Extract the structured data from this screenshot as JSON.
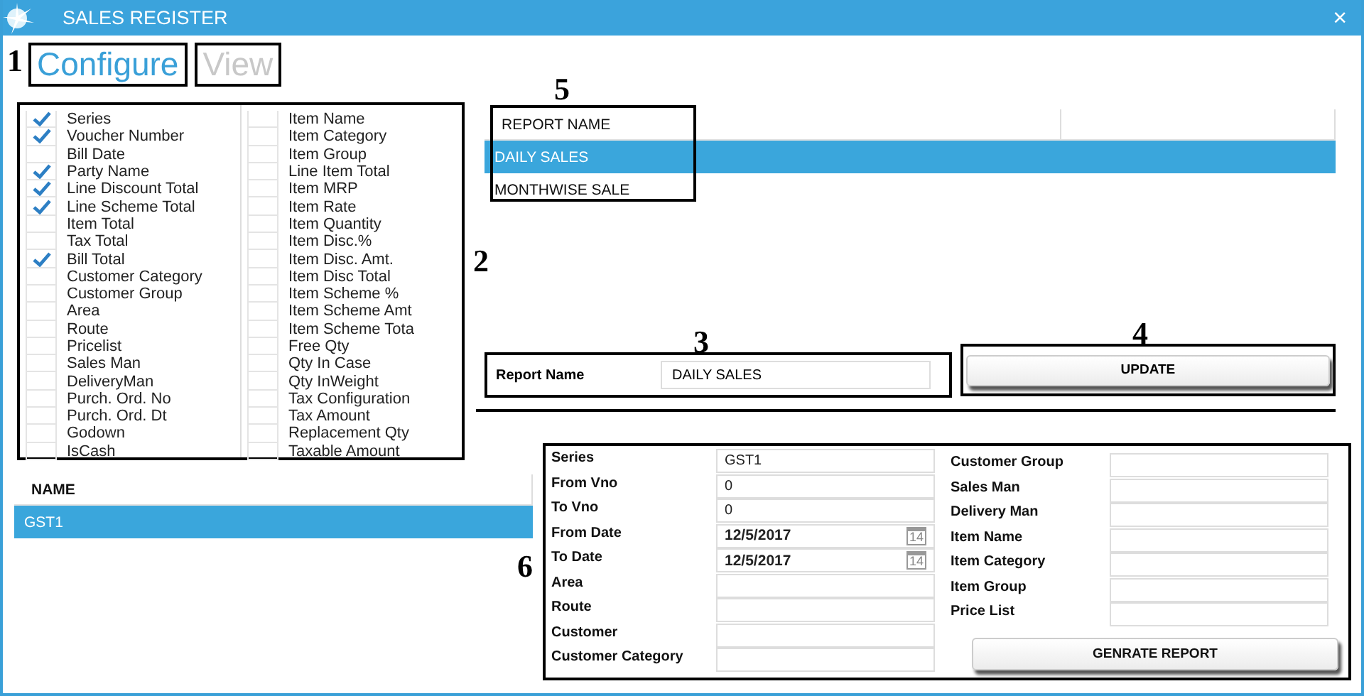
{
  "window": {
    "title": "SALES REGISTER",
    "close": "×"
  },
  "tabs": [
    {
      "label": "Configure",
      "selected": true
    },
    {
      "label": "View",
      "selected": false
    }
  ],
  "columns_panel": {
    "columns": [
      {
        "items": [
          {
            "label": "Series",
            "checked": true
          },
          {
            "label": "Voucher Number",
            "checked": true
          },
          {
            "label": "Bill Date",
            "checked": false
          },
          {
            "label": "Party Name",
            "checked": true
          },
          {
            "label": "Line Discount Total",
            "checked": true
          },
          {
            "label": "Line Scheme Total",
            "checked": true
          },
          {
            "label": "Item Total",
            "checked": false
          },
          {
            "label": "Tax Total",
            "checked": false
          },
          {
            "label": "Bill Total",
            "checked": true
          },
          {
            "label": "Customer Category",
            "checked": false
          },
          {
            "label": "Customer Group",
            "checked": false
          },
          {
            "label": "Area",
            "checked": false
          },
          {
            "label": "Route",
            "checked": false
          },
          {
            "label": "Pricelist",
            "checked": false
          },
          {
            "label": "Sales Man",
            "checked": false
          },
          {
            "label": "DeliveryMan",
            "checked": false
          },
          {
            "label": "Purch. Ord. No",
            "checked": false
          },
          {
            "label": "Purch. Ord. Dt",
            "checked": false
          },
          {
            "label": "Godown",
            "checked": false
          },
          {
            "label": "IsCash",
            "checked": false
          }
        ]
      },
      {
        "items": [
          {
            "label": "Item Name",
            "checked": false
          },
          {
            "label": "Item Category",
            "checked": false
          },
          {
            "label": "Item Group",
            "checked": false
          },
          {
            "label": "Line Item Total",
            "checked": false
          },
          {
            "label": "Item MRP",
            "checked": false
          },
          {
            "label": "Item Rate",
            "checked": false
          },
          {
            "label": "Item Quantity",
            "checked": false
          },
          {
            "label": "Item Disc.%",
            "checked": false
          },
          {
            "label": "Item Disc. Amt.",
            "checked": false
          },
          {
            "label": "Item Disc Total",
            "checked": false
          },
          {
            "label": "Item Scheme %",
            "checked": false
          },
          {
            "label": "Item Scheme Amt",
            "checked": false
          },
          {
            "label": "Item Scheme Tota",
            "checked": false
          },
          {
            "label": "Free Qty",
            "checked": false
          },
          {
            "label": "Qty In Case",
            "checked": false
          },
          {
            "label": "Qty InWeight",
            "checked": false
          },
          {
            "label": "Tax Configuration",
            "checked": false
          },
          {
            "label": "Tax Amount",
            "checked": false
          },
          {
            "label": "Replacement Qty",
            "checked": false
          },
          {
            "label": "Taxable Amount",
            "checked": false
          }
        ]
      }
    ]
  },
  "reports": {
    "column": "REPORT NAME",
    "rows": [
      {
        "name": "DAILY SALES",
        "selected": true
      },
      {
        "name": "MONTHWISE SALE",
        "selected": false
      }
    ]
  },
  "report_name": {
    "label": "Report Name",
    "value": "DAILY SALES"
  },
  "update_button": "UPDATE",
  "series_list": {
    "column": "NAME",
    "rows": [
      {
        "name": "GST1",
        "selected": true
      }
    ]
  },
  "filters": {
    "left": [
      {
        "label": "Series",
        "kind": "text",
        "value": "GST1"
      },
      {
        "label": "From Vno",
        "kind": "text",
        "value": "0"
      },
      {
        "label": "To Vno",
        "kind": "text",
        "value": "0"
      },
      {
        "label": "From Date",
        "kind": "date",
        "value": "12/5/2017",
        "calendar_day": "14"
      },
      {
        "label": "To Date",
        "kind": "date",
        "value": "12/5/2017",
        "calendar_day": "14"
      },
      {
        "label": "Area",
        "kind": "text"
      },
      {
        "label": "Route",
        "kind": "text"
      },
      {
        "label": "Customer",
        "kind": "text"
      },
      {
        "label": "Customer Category",
        "kind": "text"
      }
    ],
    "right": [
      {
        "label": "Customer Group",
        "kind": "text"
      },
      {
        "label": "Sales Man",
        "kind": "text"
      },
      {
        "label": "Delivery Man",
        "kind": "text"
      },
      {
        "label": "Item Name",
        "kind": "text"
      },
      {
        "label": "Item Category",
        "kind": "text"
      },
      {
        "label": "Item Group",
        "kind": "text"
      },
      {
        "label": "Price List",
        "kind": "text"
      }
    ],
    "button": "GENRATE REPORT"
  },
  "callouts": [
    "1",
    "2",
    "3",
    "4",
    "5",
    "6"
  ]
}
